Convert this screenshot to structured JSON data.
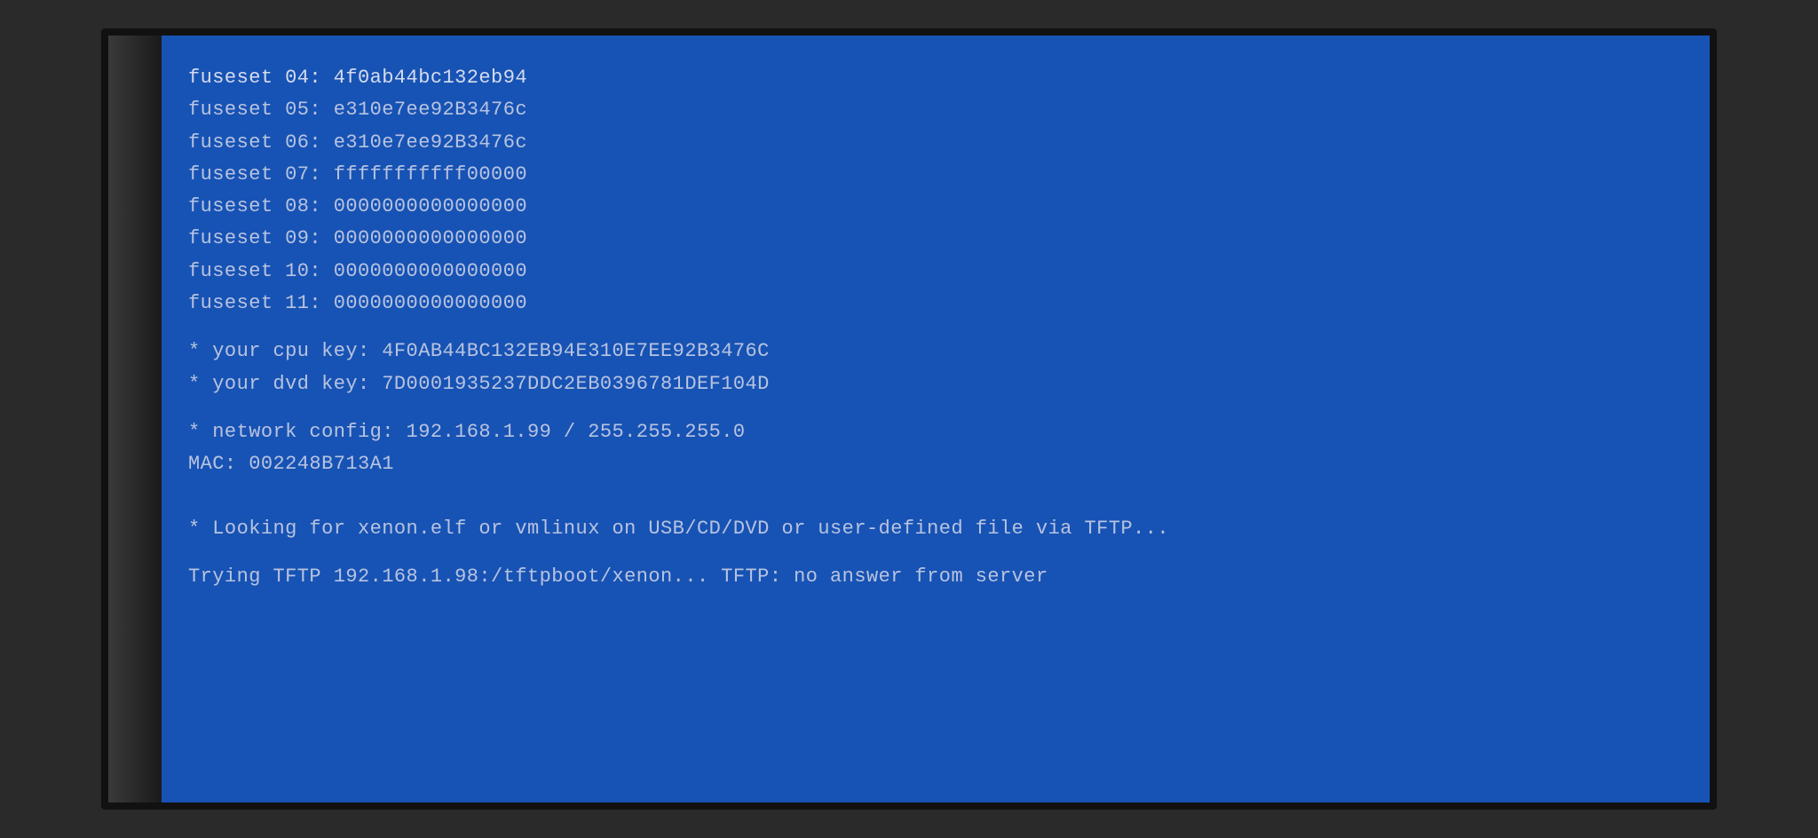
{
  "screen": {
    "lines": [
      {
        "id": "fuseset04",
        "text": "fuseset 04: 4f0ab44bc132eb94",
        "type": "bright",
        "indent": 0
      },
      {
        "id": "fuseset05",
        "text": "fuseset 05: e310e7ee92B3476c",
        "type": "normal",
        "indent": 0
      },
      {
        "id": "fuseset06",
        "text": "fuseset 06: e310e7ee92B3476c",
        "type": "normal",
        "indent": 0
      },
      {
        "id": "fuseset07",
        "text": "fuseset 07: fffffffffff00000",
        "type": "normal",
        "indent": 0
      },
      {
        "id": "fuseset08",
        "text": "fuseset 08: 0000000000000000",
        "type": "normal",
        "indent": 0
      },
      {
        "id": "fuseset09",
        "text": "fuseset 09: 0000000000000000",
        "type": "normal",
        "indent": 0
      },
      {
        "id": "fuseset10",
        "text": "fuseset 10: 0000000000000000",
        "type": "normal",
        "indent": 0
      },
      {
        "id": "fuseset11",
        "text": "fuseset 11: 0000000000000000",
        "type": "normal",
        "indent": 0
      },
      {
        "id": "spacer1",
        "text": "",
        "type": "spacer",
        "indent": 0
      },
      {
        "id": "cpukey",
        "text": "  * your cpu key: 4F0AB44BC132EB94E310E7EE92B3476C",
        "type": "normal",
        "indent": 0
      },
      {
        "id": "dvdkey",
        "text": "  * your dvd key: 7D0001935237DDC2EB0396781DEF104D",
        "type": "normal",
        "indent": 0
      },
      {
        "id": "spacer2",
        "text": "",
        "type": "spacer",
        "indent": 0
      },
      {
        "id": "netconfig",
        "text": "  * network config: 192.168.1.99 / 255.255.255.0",
        "type": "normal",
        "indent": 0
      },
      {
        "id": "mac",
        "text": "            MAC: 002248B713A1",
        "type": "normal",
        "indent": 0
      },
      {
        "id": "spacer3",
        "text": "",
        "type": "spacer",
        "indent": 0
      },
      {
        "id": "spacer4",
        "text": "",
        "type": "spacer",
        "indent": 0
      },
      {
        "id": "looking",
        "text": "  * Looking for xenon.elf or vmlinux on USB/CD/DVD or user-defined file via TFTP...",
        "type": "normal",
        "indent": 0
      },
      {
        "id": "spacer5",
        "text": "",
        "type": "spacer",
        "indent": 0
      },
      {
        "id": "tftp",
        "text": "  Trying TFTP 192.168.1.98:/tftpboot/xenon... TFTP: no answer from server",
        "type": "normal",
        "indent": 0
      }
    ]
  }
}
